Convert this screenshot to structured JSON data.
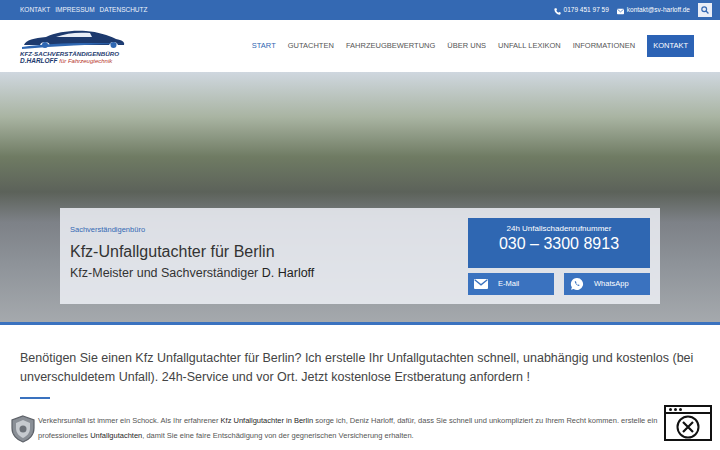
{
  "top_bar": {
    "links": [
      "KONTAKT",
      "IMPRESSUM",
      "DATENSCHUTZ"
    ],
    "phone": "0179 451 97 59",
    "email": "kontakt@sv-harloff.de"
  },
  "logo": {
    "title": "KFZ-SACHVERSTÄNDIGENBÜRO",
    "name": "D.HARLOFF",
    "subtitle": "für Fahrzeugtechnik"
  },
  "nav": {
    "items": [
      {
        "label": "START",
        "selected": true
      },
      {
        "label": "GUTACHTEN",
        "selected": false
      },
      {
        "label": "FAHRZEUGBEWERTUNG",
        "selected": false
      },
      {
        "label": "ÜBER UNS",
        "selected": false
      },
      {
        "label": "UNFALL LEXIKON",
        "selected": false
      },
      {
        "label": "INFORMATIONEN",
        "selected": false
      }
    ],
    "cta": "KONTAKT"
  },
  "hero": {
    "kicker": "Sachverständigenbüro",
    "title": "Kfz-Unfallgutachter für Berlin",
    "subtitle": "Kfz-Meister und Sachverständiger",
    "subtitle_name": "D. Harloff",
    "hotline": {
      "label": "24h Unfallschadenrufnummer",
      "number": "030 – 3300 8913"
    },
    "buttons": [
      "E-Mail",
      "WhatsApp"
    ]
  },
  "intro": {
    "lead": "Benötigen Sie einen Kfz Unfallgutachter für Berlin? Ich erstelle Ihr Unfallgutachten schnell, unabhängig und kostenlos (bei unverschuldetem Unfall). 24h-Service und vor Ort. Jetzt kostenlose Erstberatung anfordern !",
    "paragraph": [
      {
        "text": "Verkehrsunfall ist immer ein Schock. Als Ihr erfahrener ",
        "strong": false
      },
      {
        "text": "Kfz Unfallgutachter in Berlin",
        "strong": true
      },
      {
        "text": " sorge ich, Deniz Harloff, dafür, dass Sie schnell und unkompliziert zu Ihrem Recht kommen. erstelle ein professionelles ",
        "strong": false
      },
      {
        "text": "Unfallgutachten",
        "strong": true
      },
      {
        "text": ", damit Sie eine faire Entschädigung von der gegnerischen Versicherung erhalten.",
        "strong": false
      }
    ]
  }
}
